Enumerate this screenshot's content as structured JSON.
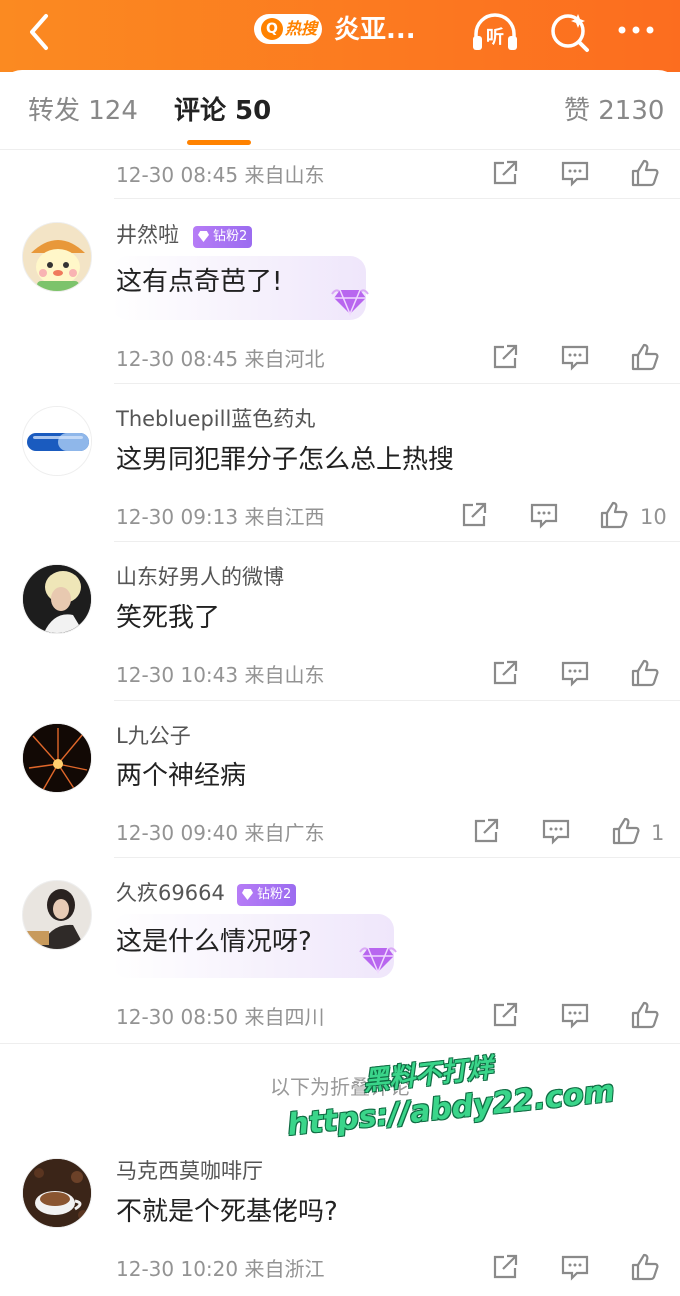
{
  "header": {
    "hot_label": "热搜",
    "title": "炎亚...",
    "listen_label": "听"
  },
  "tabs": [
    {
      "label": "转发 124"
    },
    {
      "label": "评论 50"
    },
    {
      "label": "赞 2130"
    }
  ],
  "top_meta": {
    "time": "12-30 08:45 来自山东"
  },
  "comments": [
    {
      "user": "井然啦",
      "badge": "钻粉2",
      "text": "这有点奇芭了!",
      "time": "12-30 08:45 来自河北",
      "likes": ""
    },
    {
      "user": "Thebluepill蓝色药丸",
      "badge": "",
      "text": "这男同犯罪分子怎么总上热搜",
      "time": "12-30 09:13 来自江西",
      "likes": "10"
    },
    {
      "user": "山东好男人的微博",
      "badge": "",
      "text": "笑死我了",
      "time": "12-30 10:43 来自山东",
      "likes": ""
    },
    {
      "user": "L九公子",
      "badge": "",
      "text": "两个神经病",
      "time": "12-30 09:40 来自广东",
      "likes": "1"
    },
    {
      "user": "久疚69664",
      "badge": "钻粉2",
      "text": "这是什么情况呀?",
      "time": "12-30 08:50 来自四川",
      "likes": ""
    },
    {
      "user": "马克西莫咖啡厅",
      "badge": "",
      "text": "不就是个死基佬吗?",
      "time": "12-30 10:20 来自浙江",
      "likes": ""
    }
  ],
  "folded_label": "以下为折叠评论",
  "watermark": {
    "line1": "黑料不打烊",
    "line2": "https://abdy22.com"
  },
  "colors": {
    "brand_orange": "#ff8200",
    "header_gradient_start": "#fb8a21",
    "header_gradient_end": "#fc6d1f",
    "badge_purple": "#a06ef2"
  }
}
